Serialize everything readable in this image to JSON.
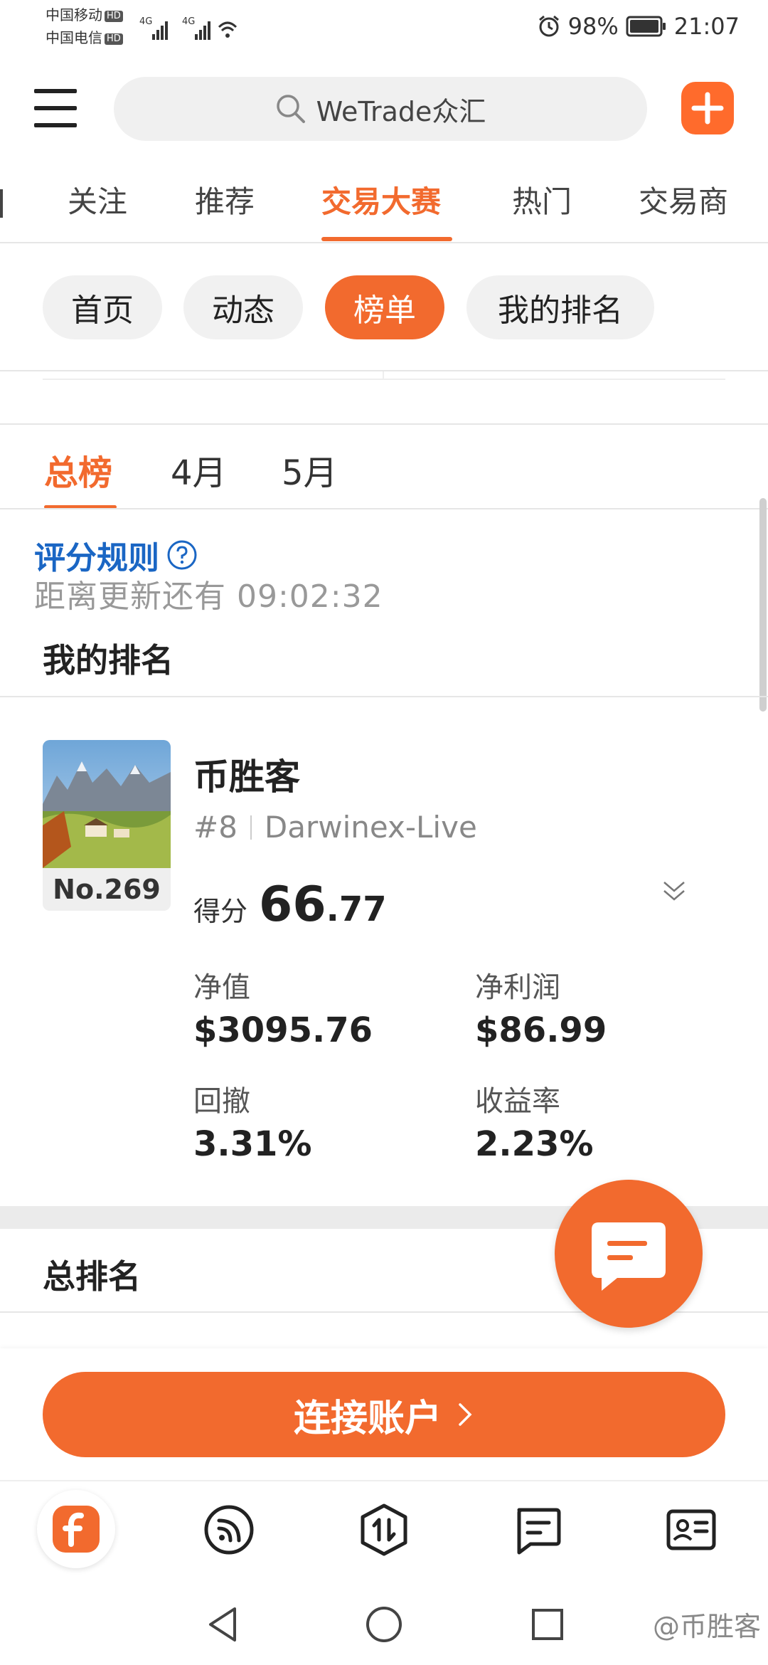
{
  "status_bar": {
    "carrier1": "中国移动",
    "carrier2": "中国电信",
    "hd": "HD",
    "network": "4G",
    "battery": "98%",
    "time": "21:07"
  },
  "header": {
    "search_placeholder": "WeTrade众汇"
  },
  "category_tabs": [
    "关注",
    "推荐",
    "交易大赛",
    "热门",
    "交易商"
  ],
  "pills": [
    "首页",
    "动态",
    "榜单",
    "我的排名"
  ],
  "period_tabs": [
    "总榜",
    "4月",
    "5月"
  ],
  "rules_label": "评分规则",
  "countdown": "距离更新还有 09:02:32",
  "my_rank_title": "我的排名",
  "card": {
    "rank_no": "No.269",
    "name": "币胜客",
    "sub_rank": "#8",
    "server": "Darwinex-Live",
    "score_label": "得分",
    "score_int": "66",
    "score_dec": ".77",
    "stats": [
      {
        "label": "净值",
        "value": "$3095.76"
      },
      {
        "label": "净利润",
        "value": "$86.99"
      },
      {
        "label": "回撤",
        "value": "3.31%"
      },
      {
        "label": "收益率",
        "value": "2.23%"
      }
    ]
  },
  "total_rank_title": "总排名",
  "connect_label": "连接账户",
  "watermark": "@币胜客",
  "colors": {
    "accent": "#f26a2e",
    "link": "#1a66c4"
  },
  "icons": [
    "menu-icon",
    "search-icon",
    "plus-icon",
    "help-icon",
    "chevron-down-icon",
    "chat-icon",
    "home-f-icon",
    "feed-icon",
    "trade-icon",
    "message-icon",
    "profile-card-icon"
  ]
}
